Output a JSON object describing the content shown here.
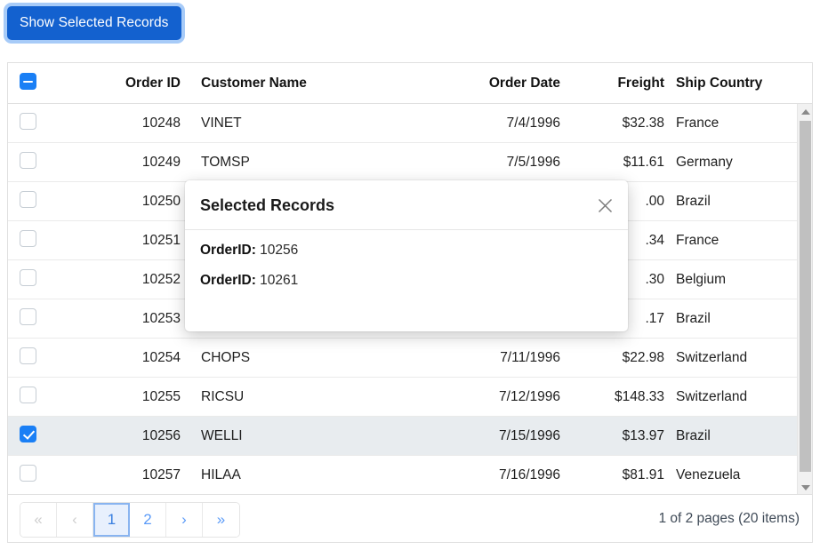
{
  "toolbar": {
    "show_selected_label": "Show Selected Records"
  },
  "grid": {
    "columns": [
      {
        "key": "checkbox",
        "label": ""
      },
      {
        "key": "order_id",
        "label": "Order ID"
      },
      {
        "key": "customer_name",
        "label": "Customer Name"
      },
      {
        "key": "order_date",
        "label": "Order Date"
      },
      {
        "key": "freight",
        "label": "Freight"
      },
      {
        "key": "ship_country",
        "label": "Ship Country"
      }
    ],
    "header_checkbox_state": "indeterminate",
    "rows": [
      {
        "selected": false,
        "order_id": "10248",
        "customer_name": "VINET",
        "order_date": "7/4/1996",
        "freight": "$32.38",
        "ship_country": "France"
      },
      {
        "selected": false,
        "order_id": "10249",
        "customer_name": "TOMSP",
        "order_date": "7/5/1996",
        "freight": "$11.61",
        "ship_country": "Germany"
      },
      {
        "selected": false,
        "order_id": "10250",
        "customer_name": "",
        "order_date": "",
        "freight": ".00",
        "ship_country": "Brazil"
      },
      {
        "selected": false,
        "order_id": "10251",
        "customer_name": "",
        "order_date": "",
        "freight": ".34",
        "ship_country": "France"
      },
      {
        "selected": false,
        "order_id": "10252",
        "customer_name": "",
        "order_date": "",
        "freight": ".30",
        "ship_country": "Belgium"
      },
      {
        "selected": false,
        "order_id": "10253",
        "customer_name": "",
        "order_date": "",
        "freight": ".17",
        "ship_country": "Brazil"
      },
      {
        "selected": false,
        "order_id": "10254",
        "customer_name": "CHOPS",
        "order_date": "7/11/1996",
        "freight": "$22.98",
        "ship_country": "Switzerland"
      },
      {
        "selected": false,
        "order_id": "10255",
        "customer_name": "RICSU",
        "order_date": "7/12/1996",
        "freight": "$148.33",
        "ship_country": "Switzerland"
      },
      {
        "selected": true,
        "order_id": "10256",
        "customer_name": "WELLI",
        "order_date": "7/15/1996",
        "freight": "$13.97",
        "ship_country": "Brazil"
      },
      {
        "selected": false,
        "order_id": "10257",
        "customer_name": "HILAA",
        "order_date": "7/16/1996",
        "freight": "$81.91",
        "ship_country": "Venezuela"
      }
    ]
  },
  "pager": {
    "first_label": "«",
    "prev_label": "‹",
    "next_label": "›",
    "last_label": "»",
    "pages": [
      "1",
      "2"
    ],
    "active_page": "1",
    "info": "1 of 2 pages (20 items)"
  },
  "dialog": {
    "title": "Selected Records",
    "close_icon": "close-icon",
    "records": [
      {
        "label": "OrderID:",
        "value": "10256"
      },
      {
        "label": "OrderID:",
        "value": "10261"
      }
    ]
  },
  "colors": {
    "accent": "#1361cf",
    "checkbox_checked": "#1a7ff5",
    "selected_row": "#e8ecef",
    "pager_link": "#5b9bf8"
  }
}
